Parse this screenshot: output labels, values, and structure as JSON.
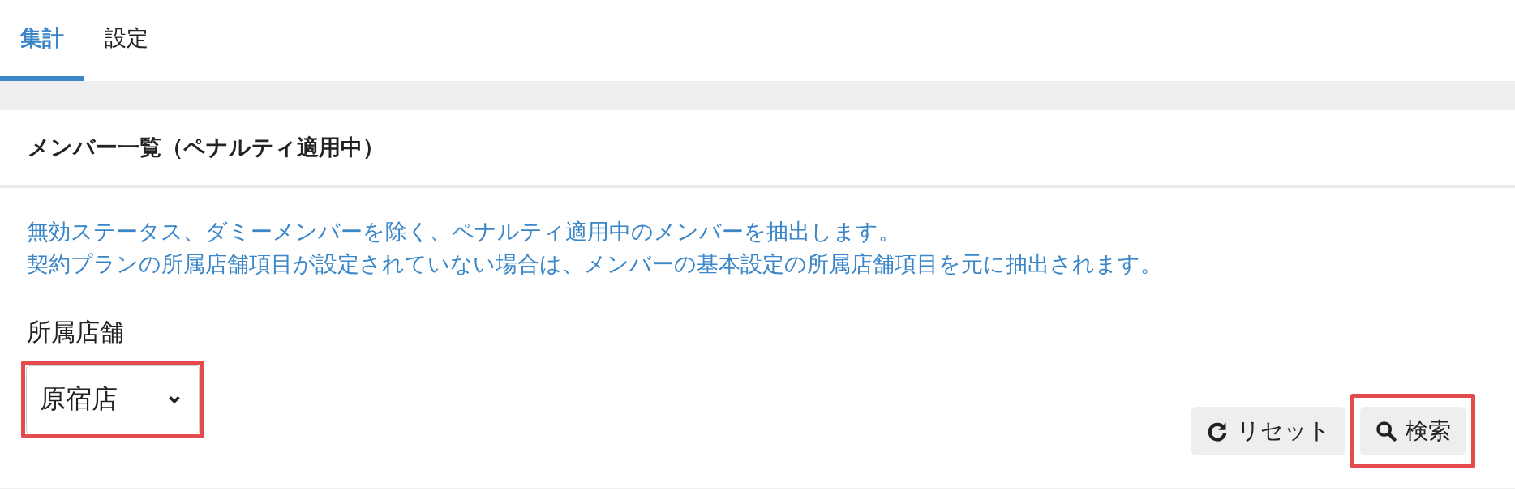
{
  "tabs": [
    {
      "label": "集計",
      "selected": true
    },
    {
      "label": "設定",
      "selected": false
    }
  ],
  "panel": {
    "title": "メンバー一覧（ペナルティ適用中）",
    "notes": [
      "無効ステータス、ダミーメンバーを除く、ペナルティ適用中のメンバーを抽出します。",
      "契約プランの所属店舗項目が設定されていない場合は、メンバーの基本設定の所属店舗項目を元に抽出されます。"
    ],
    "store_field": {
      "label": "所属店舗",
      "value": "原宿店",
      "highlighted": true
    },
    "buttons": [
      {
        "kind": "reset",
        "label": "リセット",
        "highlighted": false
      },
      {
        "kind": "search",
        "label": "検索",
        "highlighted": true
      }
    ]
  }
}
